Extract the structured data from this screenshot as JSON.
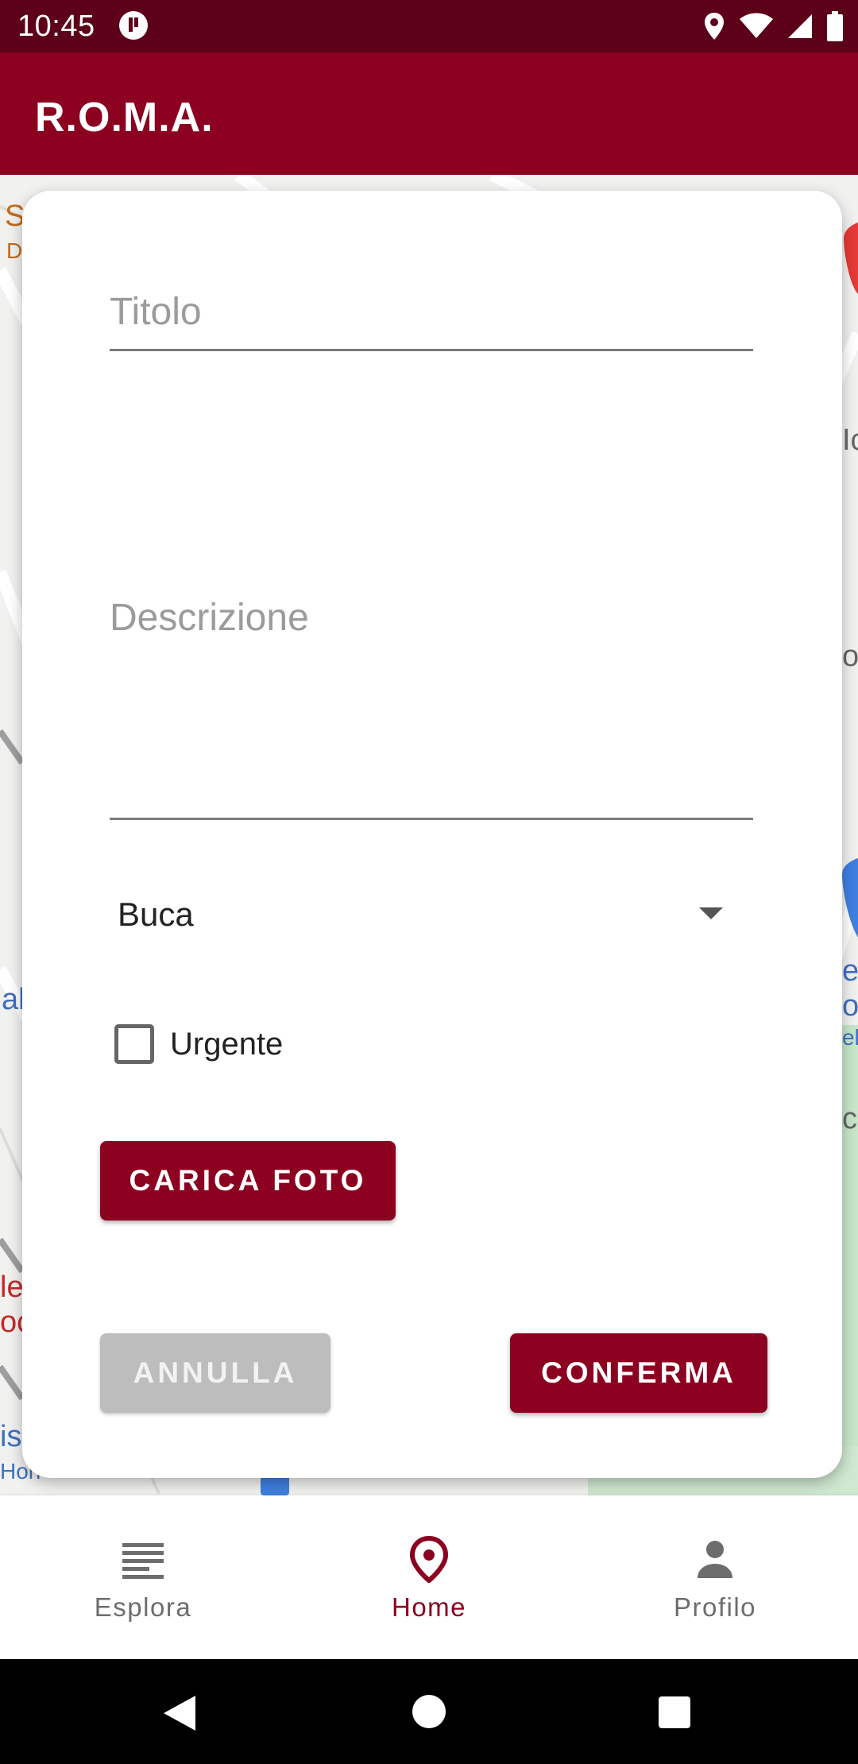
{
  "status_bar": {
    "time": "10:45",
    "icons": [
      "app-notification-icon",
      "location-icon",
      "wifi-icon",
      "signal-icon",
      "battery-icon"
    ]
  },
  "app_bar": {
    "title": "R.O.M.A."
  },
  "map": {
    "visible_labels": [
      "S",
      "D",
      "Ic",
      "or",
      "e",
      "or",
      "eliv",
      "al",
      "le",
      "oc",
      "c",
      "is",
      "Hon"
    ]
  },
  "dialog": {
    "title_field": {
      "placeholder": "Titolo",
      "value": ""
    },
    "description_field": {
      "placeholder": "Descrizione",
      "value": ""
    },
    "category_select": {
      "selected": "Buca"
    },
    "urgent_checkbox": {
      "label": "Urgente",
      "checked": false
    },
    "upload_button": {
      "label": "CARICA FOTO"
    },
    "cancel_button": {
      "label": "ANNULLA",
      "enabled": false
    },
    "confirm_button": {
      "label": "CONFERMA"
    }
  },
  "bottom_nav": {
    "items": [
      {
        "label": "Esplora",
        "icon": "list-icon",
        "active": false
      },
      {
        "label": "Home",
        "icon": "location-pin-icon",
        "active": true
      },
      {
        "label": "Profilo",
        "icon": "person-icon",
        "active": false
      }
    ]
  },
  "colors": {
    "primary": "#8c0020",
    "status_bar": "#5d0019",
    "disabled": "#bdbdbd",
    "inactive_nav": "#6d6d6d"
  }
}
